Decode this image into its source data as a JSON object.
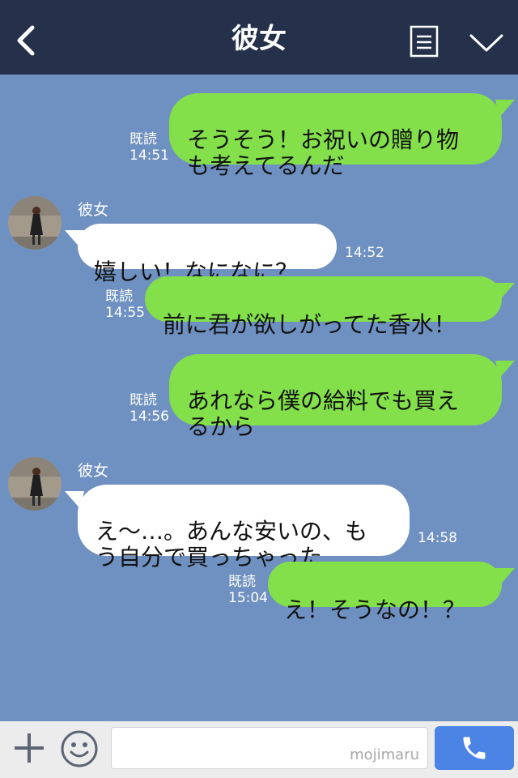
{
  "header": {
    "title": "彼女"
  },
  "messages": [
    {
      "text": "そうそう！お祝いの贈り物\nも考えてるんだ",
      "read": "既読",
      "time": "14:51"
    },
    {
      "sender": "彼女",
      "text": "嬉しい！なになに？",
      "time": "14:52"
    },
    {
      "text": "前に君が欲しがってた香水！",
      "read": "既読",
      "time": "14:55"
    },
    {
      "text": "あれなら僕の給料でも買え\nるから",
      "read": "既読",
      "time": "14:56"
    },
    {
      "sender": "彼女",
      "text": "え〜…。あんな安いの、も\nう自分で買っちゃった",
      "time": "14:58"
    },
    {
      "text": "え！そうなの！？",
      "read": "既読",
      "time": "15:04"
    }
  ],
  "composer": {
    "input_value": "",
    "watermark": "mojimaru"
  },
  "colors": {
    "header_bg": "#25304a",
    "chat_bg": "#6f91c1",
    "out_bubble": "#84e04a",
    "in_bubble": "#ffffff",
    "call_button": "#4c84e6"
  },
  "icons": [
    "back-arrow-icon",
    "menu-list-icon",
    "chevron-down-icon",
    "plus-icon",
    "emoji-icon",
    "phone-icon"
  ]
}
